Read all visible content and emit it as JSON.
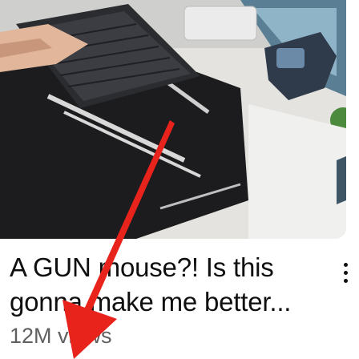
{
  "video": {
    "title_line1": "A GUN mouse?! Is this",
    "title_line2": "gonna make me better...",
    "views": "12M views"
  },
  "icons": {
    "more": "more-vert-icon",
    "annotation": "red-arrow-overlay"
  },
  "colors": {
    "title": "#0f0f0f",
    "meta": "#606060",
    "arrow": "#e8231c",
    "mousepad": "#1c1c1e"
  }
}
